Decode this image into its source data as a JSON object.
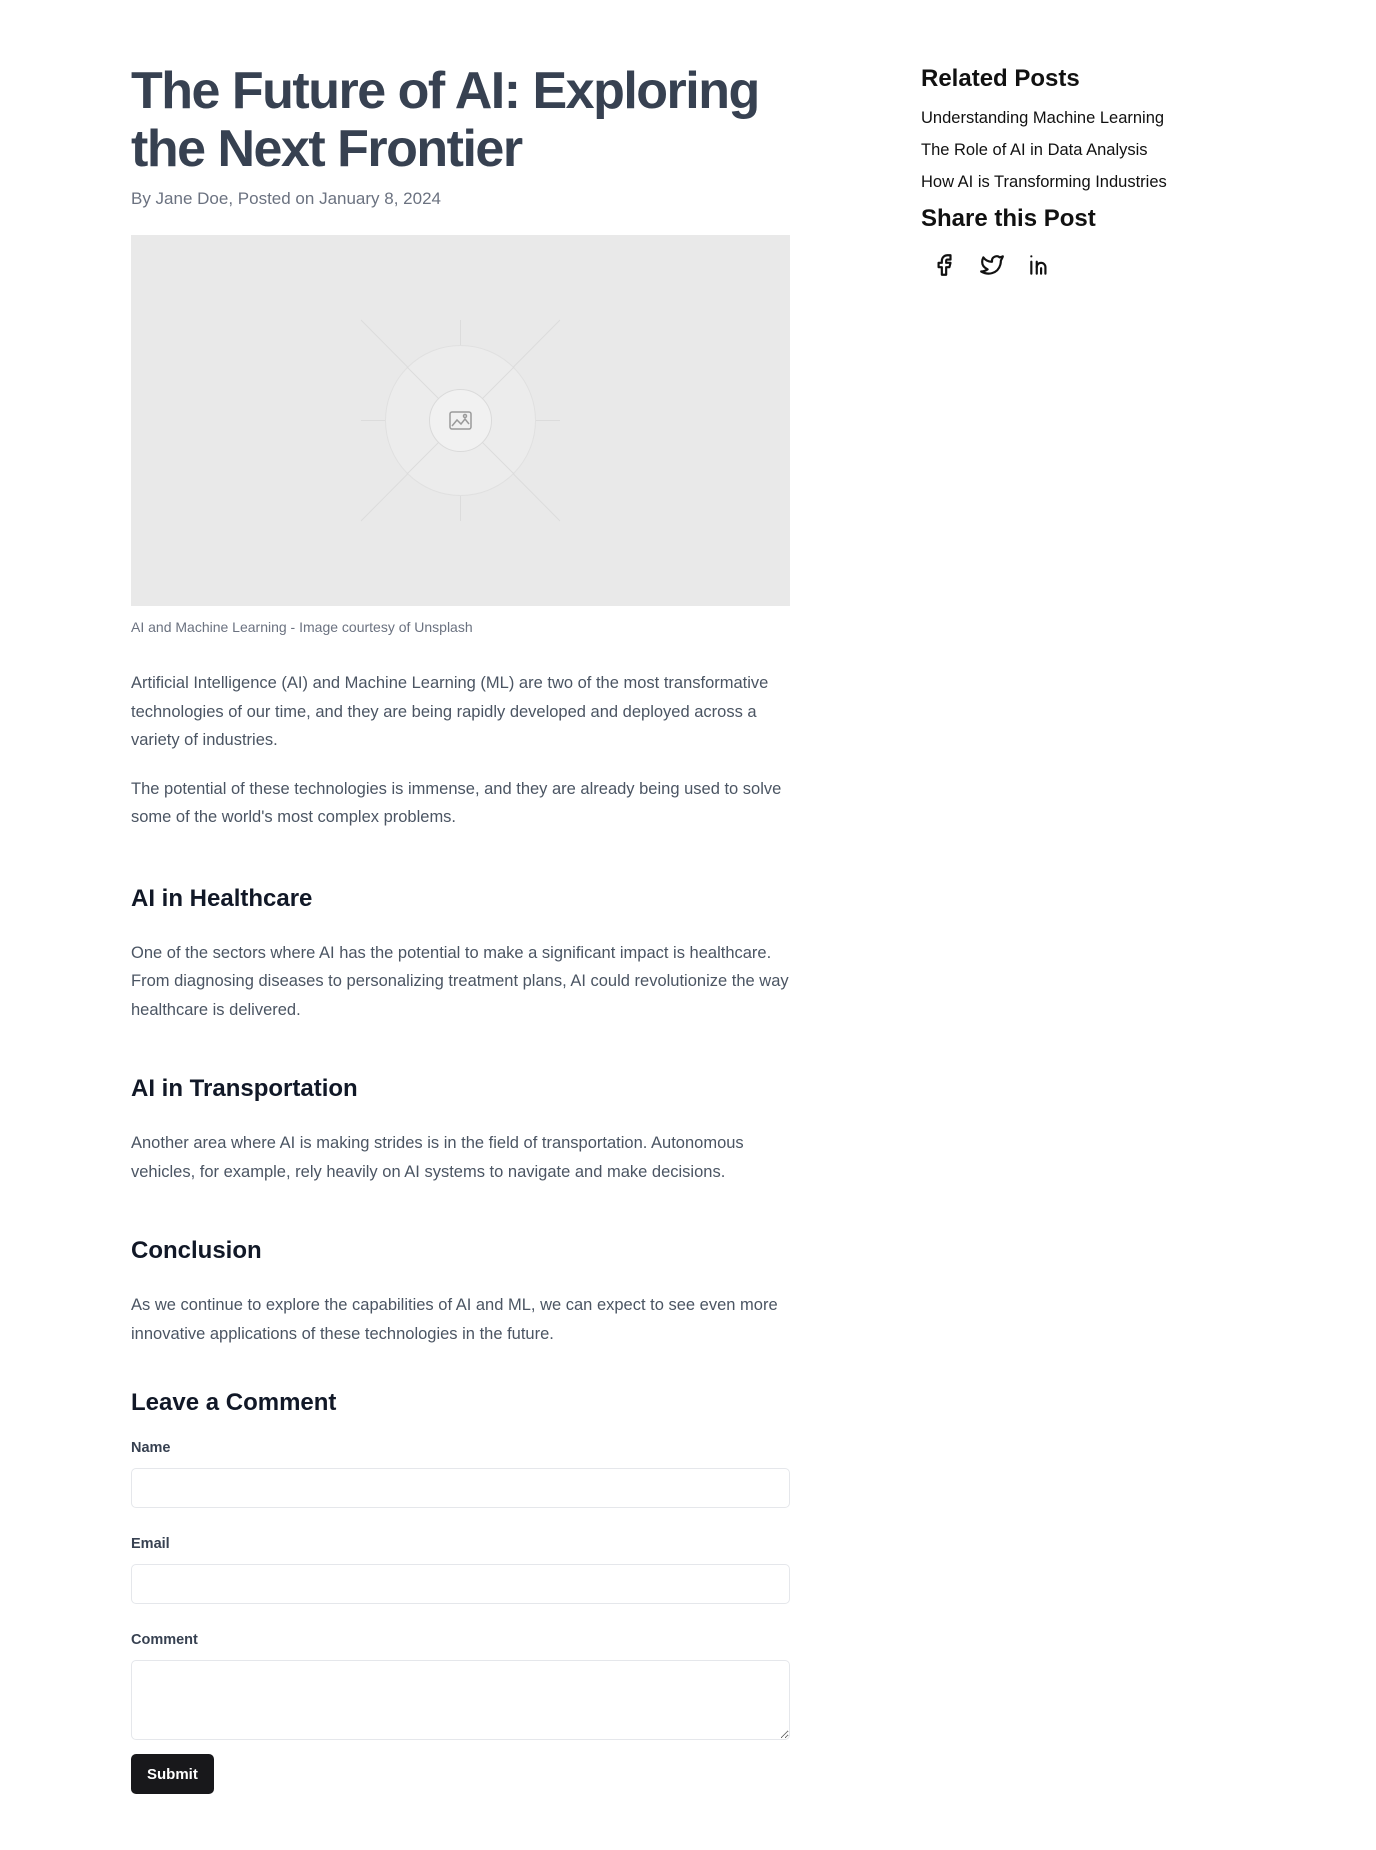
{
  "article": {
    "title": "The Future of AI: Exploring the Next Frontier",
    "byline": "By Jane Doe, Posted on January 8, 2024",
    "image_caption": "AI and Machine Learning - Image courtesy of Unsplash",
    "intro_paragraphs": [
      "Artificial Intelligence (AI) and Machine Learning (ML) are two of the most transformative technologies of our time, and they are being rapidly developed and deployed across a variety of industries.",
      "The potential of these technologies is immense, and they are already being used to solve some of the world's most complex problems."
    ],
    "sections": [
      {
        "heading": "AI in Healthcare",
        "text": "One of the sectors where AI has the potential to make a significant impact is healthcare. From diagnosing diseases to personalizing treatment plans, AI could revolutionize the way healthcare is delivered."
      },
      {
        "heading": "AI in Transportation",
        "text": "Another area where AI is making strides is in the field of transportation. Autonomous vehicles, for example, rely heavily on AI systems to navigate and make decisions."
      },
      {
        "heading": "Conclusion",
        "text": "As we continue to explore the capabilities of AI and ML, we can expect to see even more innovative applications of these technologies in the future."
      }
    ]
  },
  "comment_form": {
    "heading": "Leave a Comment",
    "name_label": "Name",
    "name_value": "",
    "email_label": "Email",
    "email_value": "",
    "comment_label": "Comment",
    "comment_value": "",
    "submit_label": "Submit"
  },
  "sidebar": {
    "related_heading": "Related Posts",
    "related_posts": [
      "Understanding Machine Learning",
      "The Role of AI in Data Analysis",
      "How AI is Transforming Industries"
    ],
    "share_heading": "Share this Post",
    "share_icons": [
      "facebook-icon",
      "twitter-icon",
      "linkedin-icon"
    ]
  },
  "colors": {
    "heading": "#374151",
    "body_text": "#4b5563",
    "muted": "#6b7280",
    "button_bg": "#18181b",
    "image_placeholder": "#e9e9e9"
  }
}
